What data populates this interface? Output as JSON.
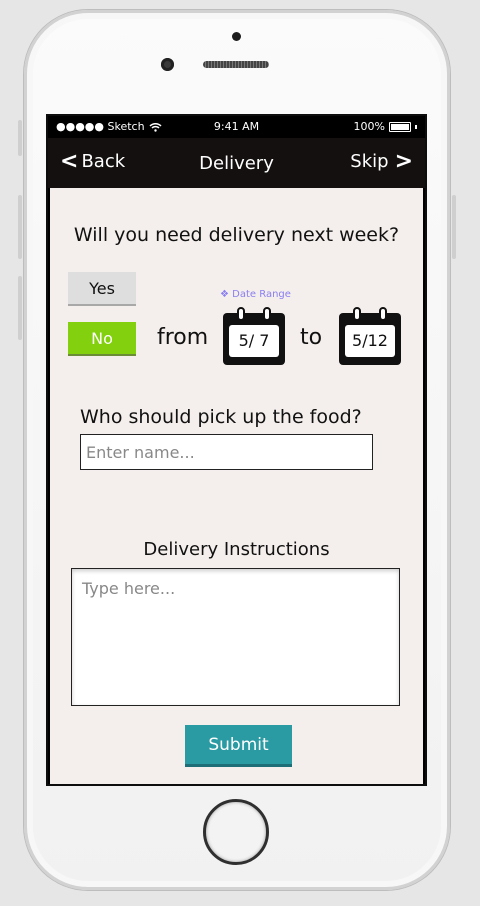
{
  "statusbar": {
    "carrier": "●●●●● Sketch",
    "time": "9:41 AM",
    "battery": "100%"
  },
  "navbar": {
    "back_label": "Back",
    "title": "Delivery",
    "skip_label": "Skip"
  },
  "form": {
    "question": "Will you need delivery next week?",
    "yes_label": "Yes",
    "no_label": "No",
    "selected": "No",
    "from_label": "from",
    "to_label": "to",
    "date_range_label": "❖ Date Range",
    "start_date": "5/ 7",
    "end_date": "5/12",
    "pickup_question": "Who should pick up the food?",
    "name_placeholder": "Enter name...",
    "instructions_label": "Delivery Instructions",
    "instructions_placeholder": "Type here...",
    "submit_label": "Submit"
  },
  "colors": {
    "accent_green": "#82d00e",
    "submit_teal": "#2a9aa3",
    "date_range_purple": "#8a7ef2",
    "nav_bg": "#151010",
    "content_bg": "#f4efec"
  }
}
